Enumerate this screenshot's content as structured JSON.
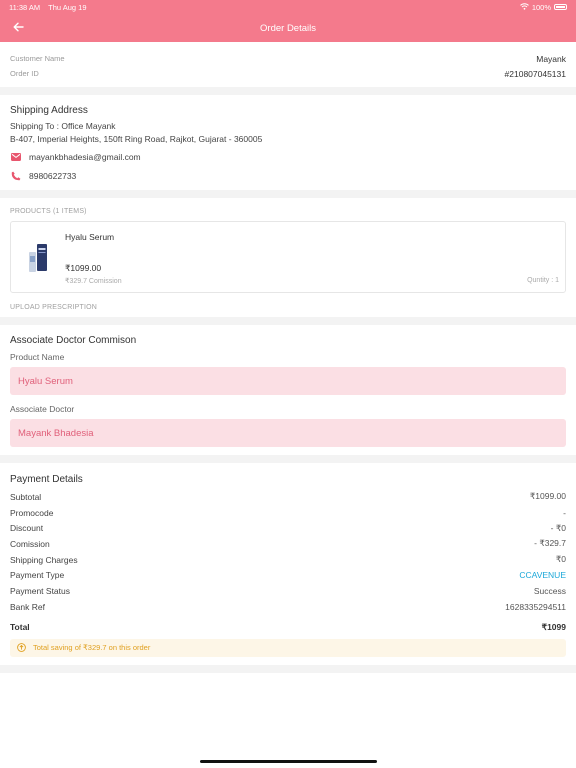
{
  "status_bar": {
    "time": "11:38 AM",
    "date": "Thu Aug 19",
    "battery": "100%"
  },
  "header": {
    "title": "Order Details"
  },
  "order": {
    "customer_label": "Customer Name",
    "customer_value": "Mayank",
    "order_id_label": "Order ID",
    "order_id_value": "#210807045131"
  },
  "shipping": {
    "title": "Shipping Address",
    "ship_to": "Shipping To : Office Mayank",
    "address": "B-407, Imperial Heights, 150ft Ring Road, Rajkot, Gujarat - 360005",
    "email": "mayankbhadesia@gmail.com",
    "phone": "8980622733"
  },
  "products": {
    "heading": "PRODUCTS (1 ITEMS)",
    "items": [
      {
        "name": "Hyalu Serum",
        "price": "₹1099.00",
        "commission": "₹329.7 Comission",
        "quantity": "Quntity : 1"
      }
    ]
  },
  "upload": {
    "heading": "UPLOAD PRESCRIPTION"
  },
  "doctor": {
    "title": "Associate Doctor Commison",
    "product_label": "Product Name",
    "product_value": "Hyalu Serum",
    "doctor_label": "Associate Doctor",
    "doctor_value": "Mayank Bhadesia"
  },
  "payment": {
    "title": "Payment Details",
    "rows": [
      {
        "label": "Subtotal",
        "value": "₹1099.00"
      },
      {
        "label": "Promocode",
        "value": "-"
      },
      {
        "label": "Discount",
        "value": "- ₹0"
      },
      {
        "label": "Comission",
        "value": "- ₹329.7"
      },
      {
        "label": "Shipping Charges",
        "value": "₹0"
      },
      {
        "label": "Payment Type",
        "value": "CCAVENUE"
      },
      {
        "label": "Payment Status",
        "value": "Success"
      },
      {
        "label": "Bank Ref",
        "value": "1628335294511"
      }
    ],
    "total_label": "Total",
    "total_value": "₹1099",
    "saving_text": "Total saving of ₹329.7 on this order"
  },
  "colors": {
    "accent": "#f47a8c",
    "field_bg": "#fbdfe4",
    "field_text": "#e0607a",
    "link_blue": "#1aa7d8",
    "saving_bg": "#fdf6e7",
    "saving_text": "#e0a020"
  },
  "icons": {
    "back": "arrow-left-icon",
    "email": "mail-icon",
    "phone": "phone-icon",
    "saving": "coin-icon",
    "wifi": "wifi-icon",
    "battery": "battery-icon"
  }
}
